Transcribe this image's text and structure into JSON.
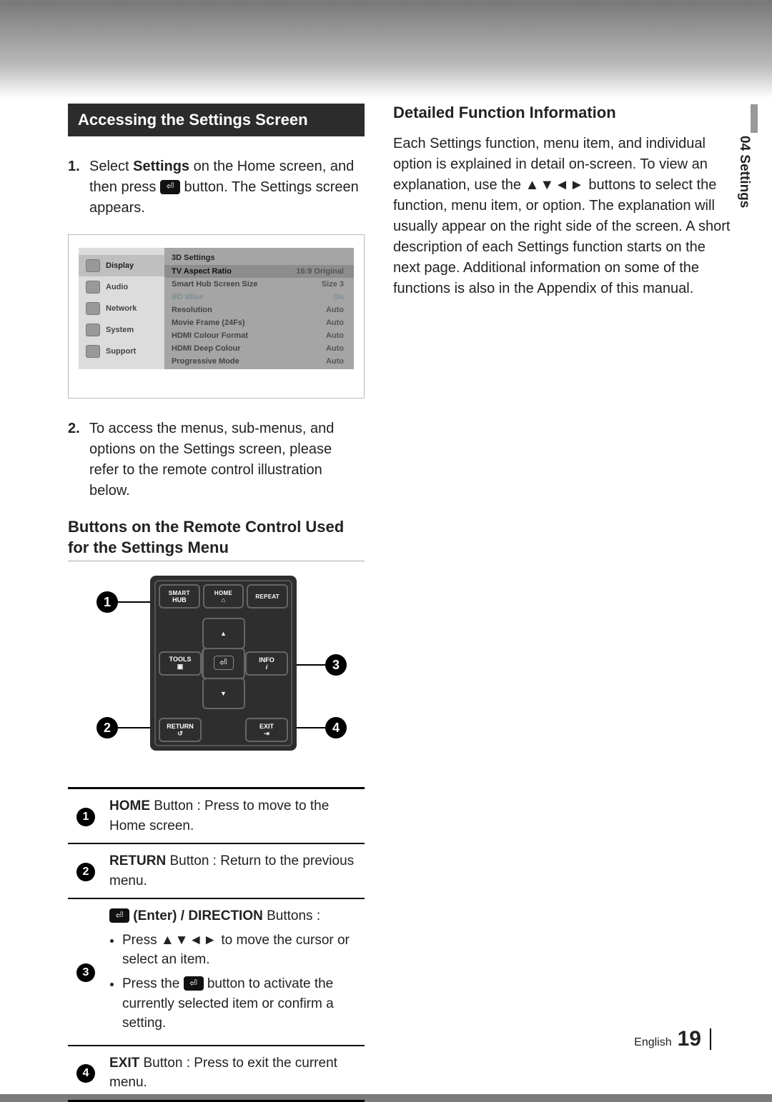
{
  "side_tab": "04  Settings",
  "section_title": "Accessing the Settings Screen",
  "steps": {
    "s1_num": "1.",
    "s1_a": "Select ",
    "s1_b": "Settings",
    "s1_c": " on the Home screen, and then press ",
    "s1_d": " button. The Settings screen appears.",
    "s2_num": "2.",
    "s2": "To access the menus, sub-menus, and options on the Settings screen, please refer to the remote control illustration below."
  },
  "subhead_remote": "Buttons on the Remote Control Used for the Settings Menu",
  "settings_shot": {
    "sidebar": [
      "Display",
      "Audio",
      "Network",
      "System",
      "Support"
    ],
    "main_title": "3D Settings",
    "rows": [
      {
        "label": "TV Aspect Ratio",
        "value": "16:9 Original",
        "cls": "hl"
      },
      {
        "label": "Smart Hub Screen Size",
        "value": "Size 3",
        "cls": ""
      },
      {
        "label": "BD Wise",
        "value": "On",
        "cls": "dim"
      },
      {
        "label": "Resolution",
        "value": "Auto",
        "cls": ""
      },
      {
        "label": "Movie Frame (24Fs)",
        "value": "Auto",
        "cls": ""
      },
      {
        "label": "HDMI Colour Format",
        "value": "Auto",
        "cls": ""
      },
      {
        "label": "HDMI Deep Colour",
        "value": "Auto",
        "cls": ""
      },
      {
        "label": "Progressive Mode",
        "value": "Auto",
        "cls": ""
      }
    ]
  },
  "remote_labels": {
    "smart": "SMART",
    "hub": "HUB",
    "home": "HOME",
    "repeat": "REPEAT",
    "tools": "TOOLS",
    "info": "INFO",
    "return": "RETURN",
    "exit": "EXIT"
  },
  "callouts": {
    "c1": "1",
    "c2": "2",
    "c3": "3",
    "c4": "4"
  },
  "btable": {
    "r1": {
      "num": "1",
      "strong": "HOME",
      "rest": " Button : Press to move to the Home screen."
    },
    "r2": {
      "num": "2",
      "strong": "RETURN",
      "rest": " Button : Return to the previous menu."
    },
    "r3": {
      "num": "3",
      "lead_strong": " (Enter) / DIRECTION",
      "lead_rest": " Buttons :",
      "li1_a": "Press ",
      "li1_b": " to move the cursor or select an item.",
      "li2_a": "Press the ",
      "li2_b": " button to activate the currently selected item or confirm a setting."
    },
    "r4": {
      "num": "4",
      "strong": "EXIT",
      "rest": " Button : Press to exit the current menu."
    }
  },
  "right": {
    "heading": "Detailed Function Information",
    "body_a": "Each Settings function, menu item, and individual option is explained in detail on-screen. To view an explanation, use the ",
    "body_b": " buttons to select the function, menu item, or option. The explanation will usually appear on the right side of the screen. A short description of each Settings function starts on the next page. Additional information on some of the functions is also in the Appendix of this manual."
  },
  "arrows4": "▲▼◄►",
  "footer": {
    "lang": "English",
    "page": "19"
  }
}
